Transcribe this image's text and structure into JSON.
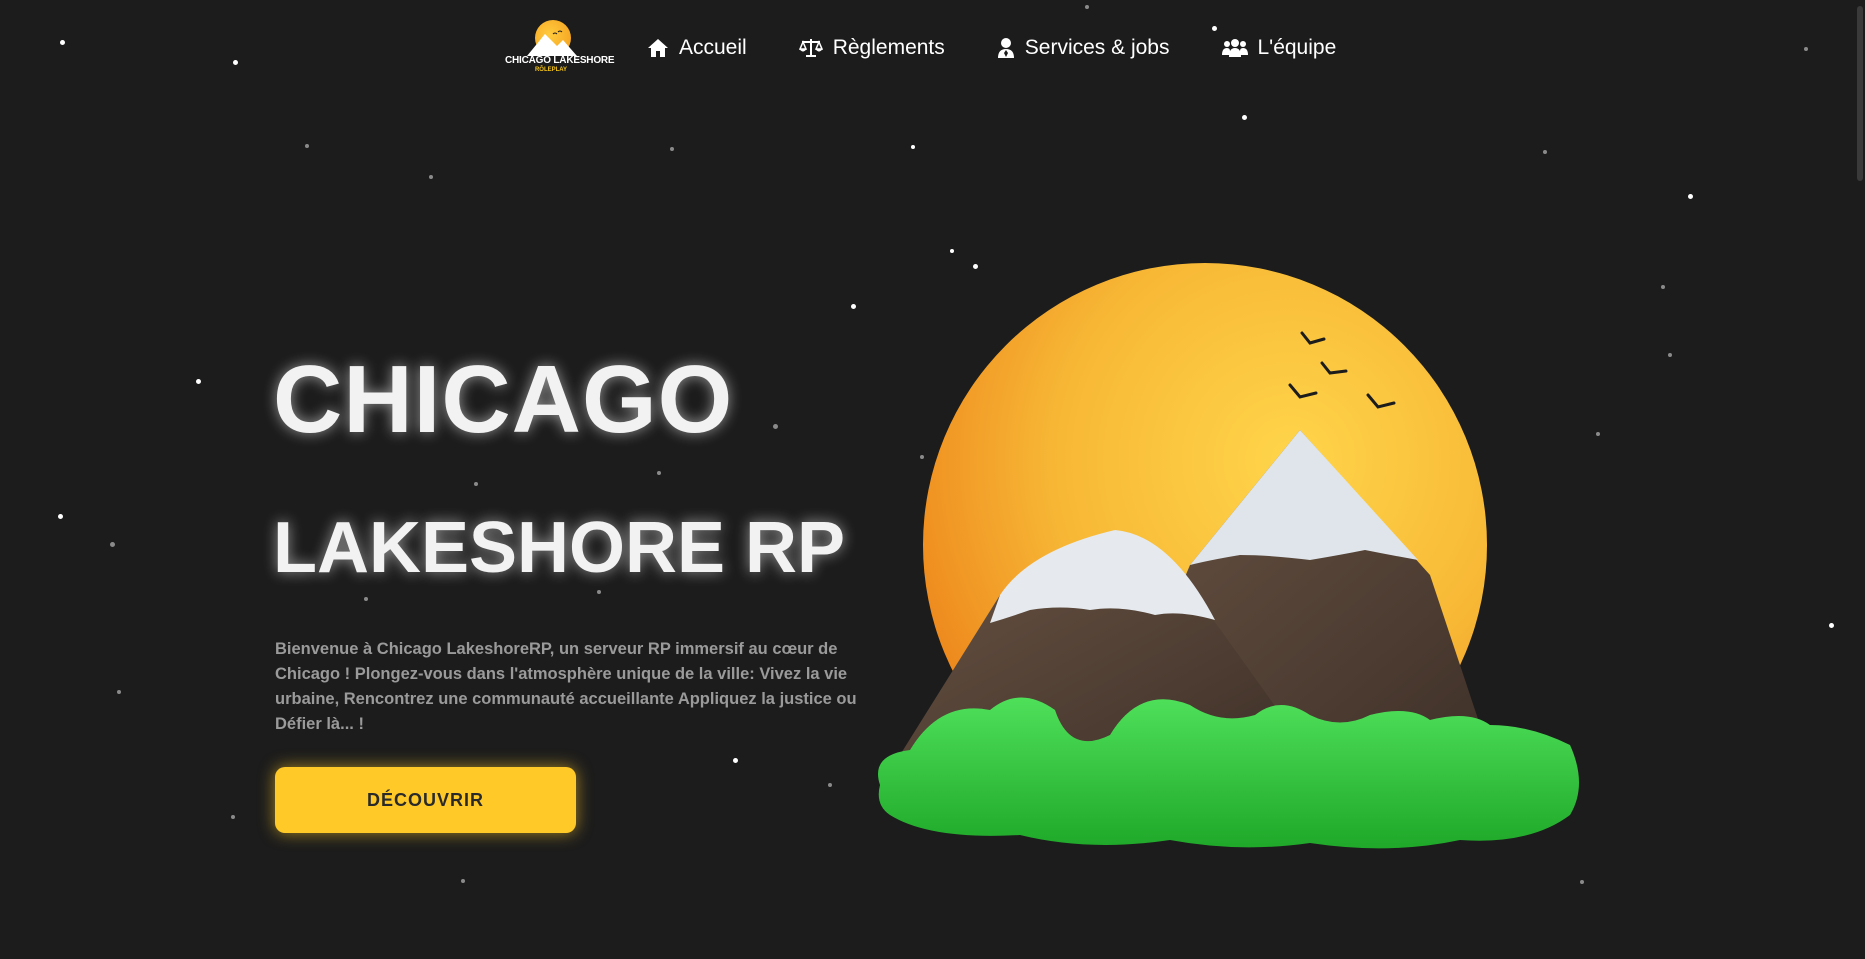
{
  "nav": {
    "logo": {
      "line1": "CHICAGO LAKESHORE",
      "line2": "RÔLEPLAY",
      "icon": "sun-mountain-logo"
    },
    "items": [
      {
        "label": "Accueil",
        "icon": "home-icon"
      },
      {
        "label": "Règlements",
        "icon": "scales-icon"
      },
      {
        "label": "Services & jobs",
        "icon": "user-tie-icon"
      },
      {
        "label": "L'équipe",
        "icon": "users-icon"
      }
    ]
  },
  "hero": {
    "title_line1": "CHICAGO",
    "title_line2": "LAKESHORE RP",
    "intro": "Bienvenue à Chicago LakeshoreRP, un serveur RP immersif au cœur de Chicago ! Plongez-vous dans l'atmosphère unique de la ville: Vivez la vie urbaine, Rencontrez une communauté accueillante Appliquez la justice ou Défier là... !",
    "cta_label": "DÉCOUVRIR",
    "illustration": "sun-mountains-illustration"
  },
  "colors": {
    "background": "#1c1c1c",
    "accent": "#ffca28",
    "text": "#f2f2f2",
    "muted": "#9a9a9a"
  }
}
